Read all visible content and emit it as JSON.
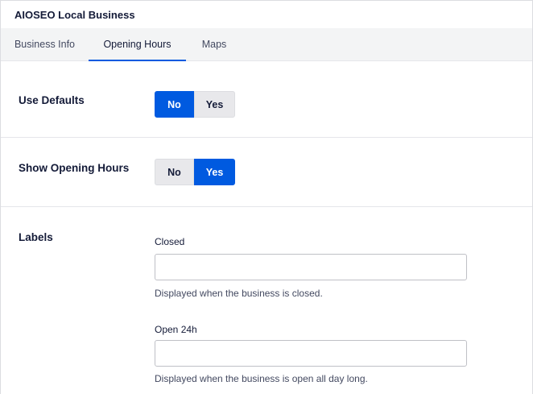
{
  "panel": {
    "title": "AIOSEO Local Business"
  },
  "tabs": [
    {
      "label": "Business Info"
    },
    {
      "label": "Opening Hours",
      "active": true
    },
    {
      "label": "Maps"
    }
  ],
  "use_defaults": {
    "label": "Use Defaults",
    "options": [
      "No",
      "Yes"
    ],
    "selected": "No"
  },
  "show_opening_hours": {
    "label": "Show Opening Hours",
    "options": [
      "No",
      "Yes"
    ],
    "selected": "Yes"
  },
  "labels": {
    "label": "Labels",
    "closed": {
      "field_label": "Closed",
      "value": "",
      "help": "Displayed when the business is closed."
    },
    "open24": {
      "field_label": "Open 24h",
      "value": "",
      "help": "Displayed when the business is open all day long."
    }
  },
  "colors": {
    "accent": "#005ae0",
    "toggle_inactive": "#e8e8eb",
    "tab_bar": "#f3f4f5"
  }
}
